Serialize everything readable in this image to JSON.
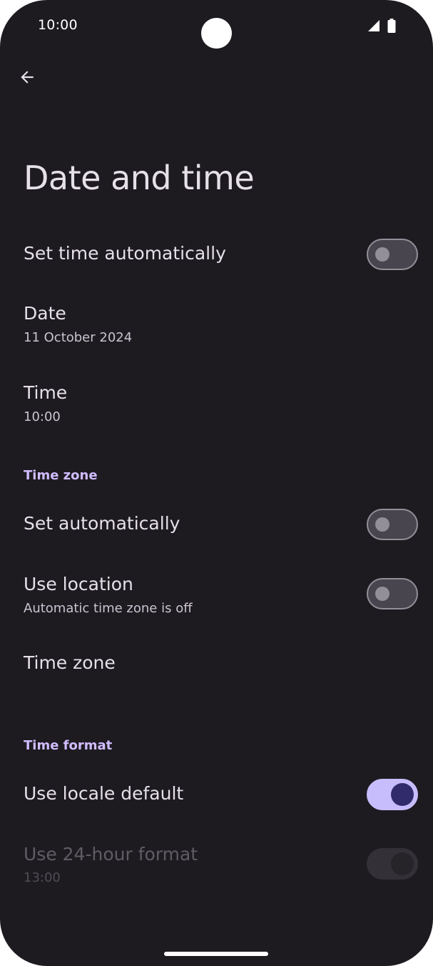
{
  "status_bar": {
    "time": "10:00",
    "signal_icon": "cell-signal-icon",
    "battery_icon": "battery-icon"
  },
  "app_bar": {
    "back_icon": "arrow-back-icon",
    "title": "Date and time"
  },
  "settings": {
    "set_time_automatically": {
      "title": "Set time automatically",
      "switch": "off"
    },
    "date": {
      "title": "Date",
      "summary": "11 October 2024"
    },
    "time": {
      "title": "Time",
      "summary": "10:00"
    }
  },
  "time_zone_section": {
    "header": "Time zone",
    "set_automatically": {
      "title": "Set automatically",
      "switch": "off"
    },
    "use_location": {
      "title": "Use location",
      "summary": "Automatic time zone is off",
      "switch": "off"
    },
    "time_zone": {
      "title": "Time zone"
    }
  },
  "time_format_section": {
    "header": "Time format",
    "use_locale_default": {
      "title": "Use locale default",
      "switch": "on"
    },
    "use_24_hour": {
      "title": "Use 24-hour format",
      "summary": "13:00",
      "switch": "on",
      "enabled": false
    }
  },
  "colors": {
    "background": "#1d1b20",
    "accent": "#c7bdfc",
    "section_header": "#d0bcff",
    "text_primary": "#e6e0e9",
    "text_secondary": "#cac4d0"
  }
}
